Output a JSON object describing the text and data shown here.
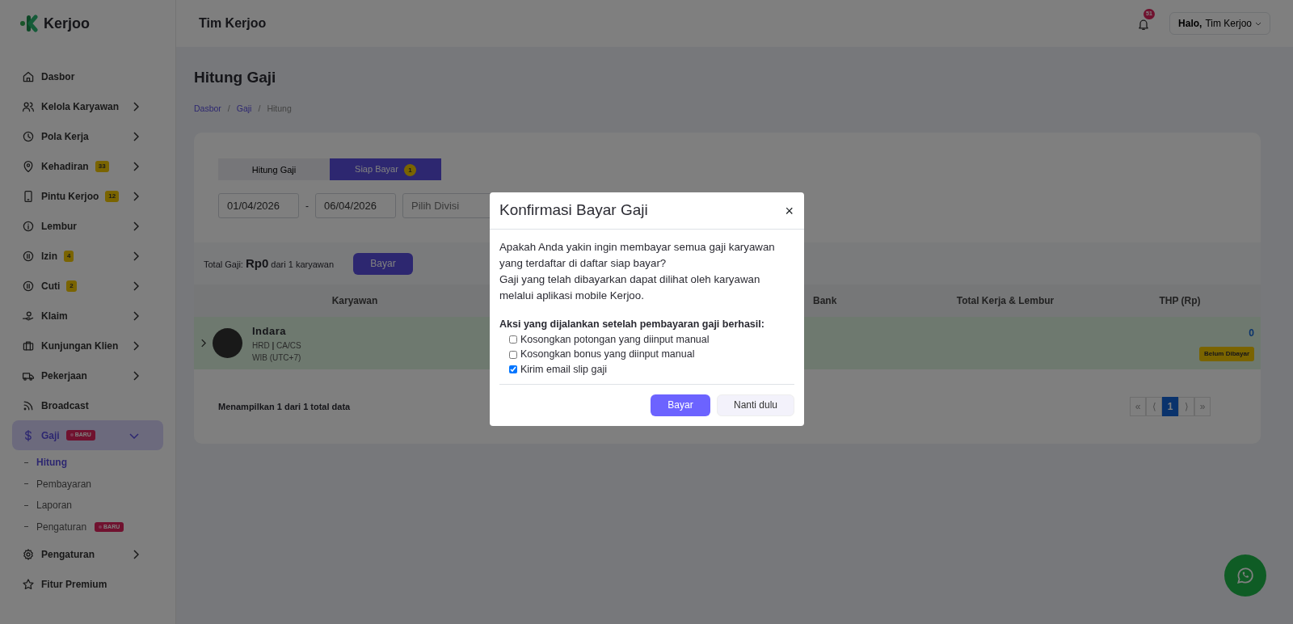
{
  "brand": {
    "name": "Kerjoo"
  },
  "topbar": {
    "title": "Tim Kerjoo",
    "notifications": "51",
    "greeting": "Halo,",
    "user": "Tim Kerjoo"
  },
  "sidebar": {
    "items": [
      {
        "label": "Dasbor",
        "selected": false
      },
      {
        "label": "Kelola Karyawan",
        "expanded": false,
        "selected": false
      },
      {
        "label": "Pola Kerja",
        "expanded": false,
        "selected": false
      },
      {
        "label": "Kehadiran",
        "badge": {
          "text": "33",
          "kind": "count"
        },
        "expanded": false,
        "selected": false
      },
      {
        "label": "Pintu Kerjoo",
        "badge": {
          "text": "12",
          "kind": "count"
        },
        "expanded": false,
        "selected": false
      },
      {
        "label": "Lembur",
        "expanded": false,
        "selected": false
      },
      {
        "label": "Izin",
        "badge": {
          "text": "4",
          "kind": "count"
        },
        "expanded": false,
        "selected": false
      },
      {
        "label": "Cuti",
        "badge": {
          "text": "2",
          "kind": "count"
        },
        "expanded": false,
        "selected": false
      },
      {
        "label": "Klaim",
        "expanded": false,
        "selected": false
      },
      {
        "label": "Kunjungan Klien",
        "expanded": false,
        "selected": false
      },
      {
        "label": "Pekerjaan",
        "expanded": false,
        "selected": false
      },
      {
        "label": "Broadcast",
        "selected": false
      },
      {
        "label": "Gaji",
        "badge": {
          "text": "BARU",
          "kind": "new"
        },
        "expanded": true,
        "selected": true,
        "children": [
          {
            "label": "Hitung",
            "selected": true
          },
          {
            "label": "Pembayaran",
            "selected": false
          },
          {
            "label": "Laporan",
            "selected": false
          },
          {
            "label": "Pengaturan",
            "selected": false,
            "badge": {
              "text": "BARU",
              "kind": "new"
            }
          }
        ]
      },
      {
        "label": "Pengaturan",
        "expanded": false,
        "selected": false
      },
      {
        "label": "Fitur Premium",
        "selected": false
      }
    ]
  },
  "page": {
    "title": "Hitung Gaji",
    "breadcrumb": [
      "Dasbor",
      "Gaji",
      "Hitung"
    ],
    "breadcrumb_separator": "/"
  },
  "tabs": [
    {
      "label": "Hitung Gaji",
      "selected": false
    },
    {
      "label": "Siap Bayar",
      "count": "1",
      "selected": true
    }
  ],
  "filters": {
    "date_from": "01/04/2026",
    "separator": "-",
    "date_to": "06/04/2026",
    "division_placeholder": "Pilih Divisi"
  },
  "summary": {
    "label": "Total Gaji:",
    "amount": "Rp0",
    "suffix": "dari 1 karyawan",
    "button": "Bayar"
  },
  "table": {
    "columns": [
      "Karyawan",
      "Bank",
      "Total Kerja & Lembur",
      "THP (Rp)"
    ],
    "rows": [
      {
        "name": "Indara",
        "role": "HRD **|** CA/CS",
        "timezone": "WIB (UTC+7)",
        "thp": "0",
        "status": "Belum Dibayar"
      }
    ]
  },
  "footer": {
    "info": "Menampilkan 1 dari 1 total data",
    "pagination": [
      {
        "label": "«",
        "selected": false
      },
      {
        "label": "⟨",
        "selected": false
      },
      {
        "label": "1",
        "selected": true
      },
      {
        "label": "⟩",
        "selected": false
      },
      {
        "label": "»",
        "selected": false
      }
    ]
  },
  "modal": {
    "title": "Konfirmasi Bayar Gaji",
    "close": "×",
    "message": [
      "Apakah Anda yakin ingin membayar semua gaji karyawan yang terdaftar di daftar siap bayar?",
      "Gaji yang telah dibayarkan dapat dilihat oleh karyawan melalui aplikasi mobile Kerjoo."
    ],
    "actions_label": "Aksi yang dijalankan setelah pembayaran gaji berhasil:",
    "options": [
      {
        "label": "Kosongkan potongan yang diinput manual",
        "checked": false
      },
      {
        "label": "Kosongkan bonus yang diinput manual",
        "checked": false
      },
      {
        "label": "Kirim email slip gaji",
        "checked": true
      }
    ],
    "buttons": [
      {
        "label": "Bayar",
        "kind": "primary"
      },
      {
        "label": "Nanti dulu",
        "kind": "secondary"
      }
    ]
  }
}
